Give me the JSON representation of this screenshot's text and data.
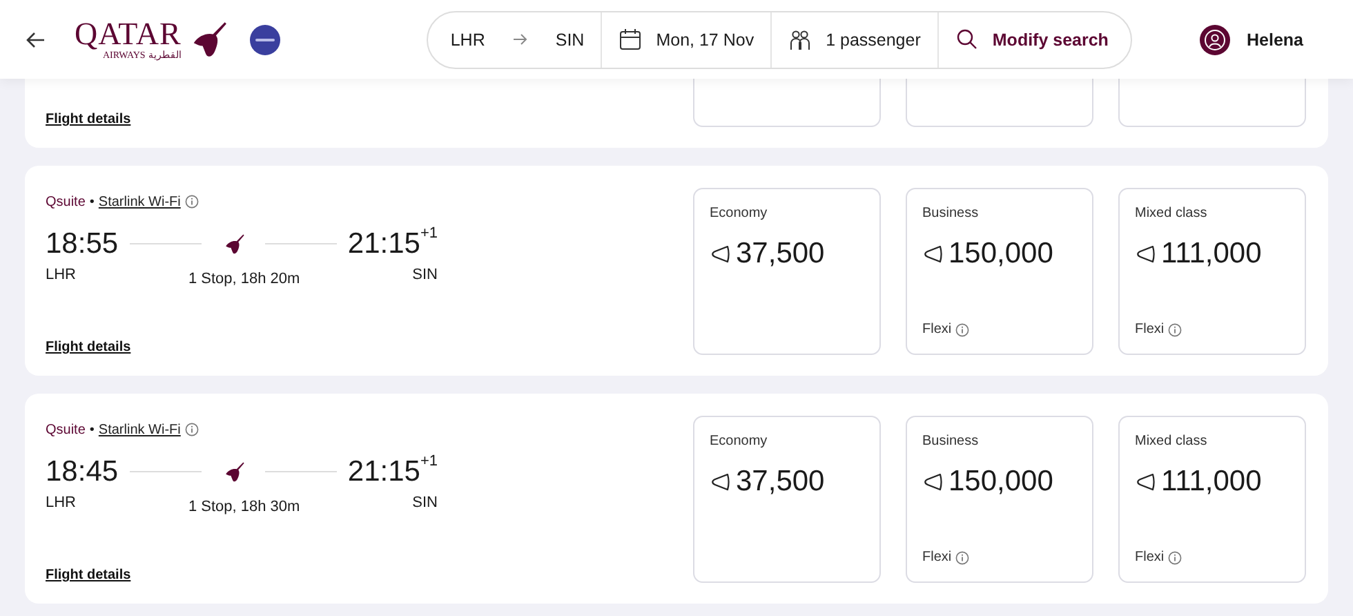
{
  "header": {
    "logo": {
      "name": "QATAR",
      "sub": "AIRWAYS",
      "arabic": "القطرية"
    },
    "search": {
      "origin": "LHR",
      "destination": "SIN",
      "date": "Mon, 17 Nov",
      "passengers": "1 passenger",
      "action": "Modify search"
    },
    "user": {
      "name": "Helena"
    }
  },
  "flights": [
    {
      "kind": "partial",
      "details_link": "Flight details"
    },
    {
      "kind": "full",
      "cabin": "Qsuite",
      "separator": "•",
      "wifi": "Starlink Wi-Fi",
      "depart": "18:55",
      "arrive": "21:15",
      "day_offset": "+1",
      "from": "LHR",
      "to": "SIN",
      "stops": "1 Stop, 18h 20m",
      "details_link": "Flight details",
      "fares": [
        {
          "cabin": "Economy",
          "price": "37,500"
        },
        {
          "cabin": "Business",
          "price": "150,000",
          "fare_type": "Flexi"
        },
        {
          "cabin": "Mixed class",
          "price": "111,000",
          "fare_type": "Flexi"
        }
      ]
    },
    {
      "kind": "full",
      "cabin": "Qsuite",
      "separator": "•",
      "wifi": "Starlink Wi-Fi",
      "depart": "18:45",
      "arrive": "21:15",
      "day_offset": "+1",
      "from": "LHR",
      "to": "SIN",
      "stops": "1 Stop, 18h 30m",
      "details_link": "Flight details",
      "fares": [
        {
          "cabin": "Economy",
          "price": "37,500"
        },
        {
          "cabin": "Business",
          "price": "150,000",
          "fare_type": "Flexi"
        },
        {
          "cabin": "Mixed class",
          "price": "111,000",
          "fare_type": "Flexi"
        }
      ]
    }
  ]
}
